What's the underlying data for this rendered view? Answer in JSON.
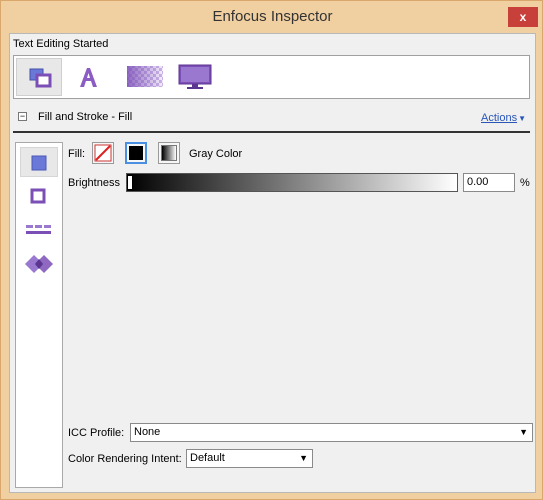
{
  "window": {
    "title": "Enfocus Inspector",
    "close_label": "x"
  },
  "status": "Text Editing Started",
  "toolbar": {
    "buttons": [
      {
        "name": "objects",
        "icon": "objects-icon",
        "active": true
      },
      {
        "name": "text",
        "icon": "text-icon",
        "active": false
      },
      {
        "name": "transparency",
        "icon": "transparency-icon",
        "active": false
      },
      {
        "name": "display",
        "icon": "monitor-icon",
        "active": false
      }
    ]
  },
  "section": {
    "collapse_glyph": "−",
    "title": "Fill and Stroke - Fill",
    "actions_label": "Actions",
    "actions_arrow": "▼"
  },
  "side_tabs": [
    {
      "name": "fill",
      "icon": "fill-square-icon",
      "active": true
    },
    {
      "name": "stroke",
      "icon": "stroke-square-icon",
      "active": false
    },
    {
      "name": "dash",
      "icon": "dash-pattern-icon",
      "active": false
    },
    {
      "name": "overprint",
      "icon": "overprint-icon",
      "active": false
    }
  ],
  "fill": {
    "label": "Fill:",
    "color_space": "Gray Color",
    "brightness_label": "Brightness",
    "brightness_value": "0.00",
    "percent": "%"
  },
  "icc": {
    "label": "ICC Profile:",
    "value": "None",
    "arrow": "▼"
  },
  "intent": {
    "label": "Color Rendering Intent:",
    "value": "Default",
    "arrow": "▼"
  },
  "colors": {
    "accent": "#7b4fb6",
    "link": "#2a56b8",
    "frame": "#f0cfa0",
    "close": "#c7403a"
  }
}
